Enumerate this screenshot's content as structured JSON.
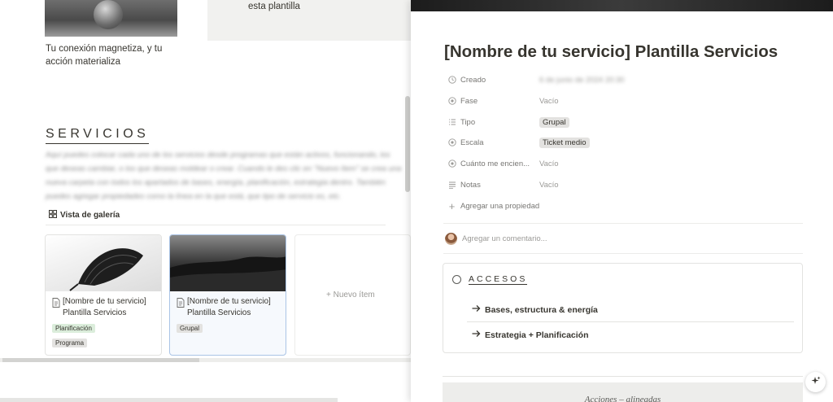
{
  "left": {
    "hero_caption": "Tu conexión magnetiza, y tu acción materializa",
    "hero_grey_text": "esta plantilla",
    "section_title": "SERVICIOS",
    "blurred_text": "Aquí puedes colocar cada uno de los servicios desde programas que están activos, funcionando, los que deseas cambiar, o los que deseas moldear o crear. Cuando le des clic en \"Nuevo Item\" se crea una nueva carpeta con todos los apartados de bases, energía, planificación, estrategia dentro. También puedes agregar propiedades como la línea en la que está, que tipo de servicio es, etc.",
    "gallery_tab": "Vista de galería",
    "cards": [
      {
        "title": "[Nombre de tu servicio] Plantilla Servicios",
        "tags": [
          {
            "label": "Planificación",
            "color": "#dbeddb"
          },
          {
            "label": "Programa",
            "color": "#e3e2e0"
          }
        ]
      },
      {
        "title": "[Nombre de tu servicio] Plantilla Servicios",
        "tags": [
          {
            "label": "Grupal",
            "color": "#e3e2e0"
          }
        ]
      }
    ],
    "new_item": "+ Nuevo ítem"
  },
  "right": {
    "page_title": "[Nombre de tu servicio] Plantilla Servicios",
    "properties": [
      {
        "name": "Creado",
        "value": "6 de junio de 2024 20:30",
        "icon": "clock-icon",
        "kind": "blurred"
      },
      {
        "name": "Fase",
        "value": "Vacío",
        "icon": "status-icon",
        "kind": "empty"
      },
      {
        "name": "Tipo",
        "value": "Grupal",
        "icon": "list-icon",
        "kind": "chip"
      },
      {
        "name": "Escala",
        "value": "Ticket medio",
        "icon": "status-icon",
        "kind": "chip"
      },
      {
        "name": "Cuánto me encien...",
        "value": "Vacío",
        "icon": "status-icon",
        "kind": "empty"
      },
      {
        "name": "Notas",
        "value": "Vacío",
        "icon": "text-icon",
        "kind": "empty"
      }
    ],
    "add_property": "Agregar una propiedad",
    "add_comment": "Agregar un comentario...",
    "accesos_title": "ACCESOS",
    "links": [
      "Bases, estructura & energía",
      "Estrategia + Planificación"
    ],
    "bottom_text": "Acciones – alineadas"
  }
}
